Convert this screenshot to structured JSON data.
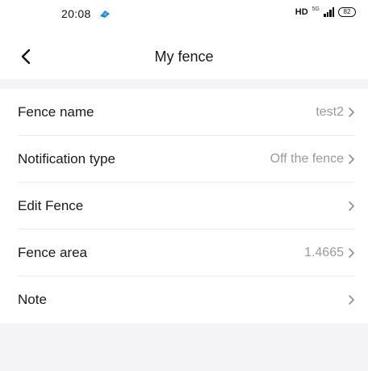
{
  "status_bar": {
    "time": "20:08",
    "hd": "HD",
    "network": "5G",
    "battery": "82"
  },
  "header": {
    "title": "My fence",
    "back_icon": "chevron-left-icon"
  },
  "settings": {
    "items": [
      {
        "label": "Fence name",
        "value": "test2"
      },
      {
        "label": "Notification type",
        "value": "Off the fence"
      },
      {
        "label": "Edit Fence",
        "value": ""
      },
      {
        "label": "Fence area",
        "value": "1.4665"
      },
      {
        "label": "Note",
        "value": ""
      }
    ]
  },
  "colors": {
    "background": "#ffffff",
    "section_gray": "#f4f4f6",
    "value_text": "#9a9a9a",
    "primary_text": "#1a1a1a"
  }
}
